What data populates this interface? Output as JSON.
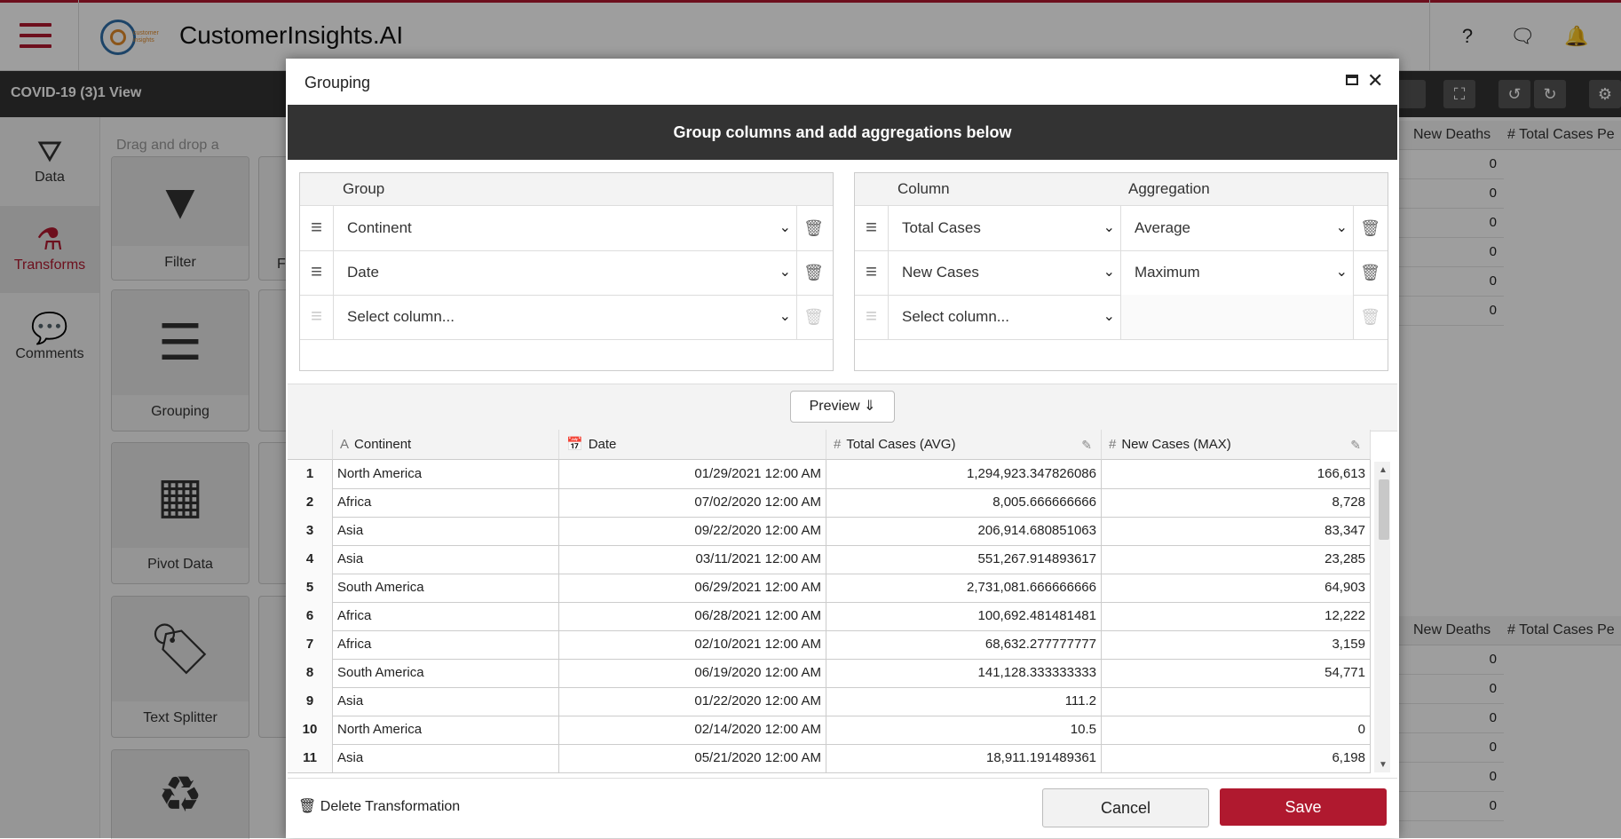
{
  "app": {
    "title": "CustomerInsights.AI",
    "logo_text": "customer insights"
  },
  "view": {
    "title": "COVID-19 (3)1 View"
  },
  "rail": [
    {
      "label": "Data",
      "icon": "database-icon"
    },
    {
      "label": "Transforms",
      "icon": "flask-icon"
    },
    {
      "label": "Comments",
      "icon": "comments-icon"
    }
  ],
  "transforms_panel": {
    "hint": "Drag and drop a transformation",
    "tiles": [
      {
        "label": "Filter",
        "icon": "filter-icon"
      },
      {
        "label": "Grouping",
        "icon": "grouping-icon"
      },
      {
        "label": "Pivot Data",
        "icon": "pivot-icon"
      },
      {
        "label": "Text Splitter",
        "icon": "tag-icon"
      },
      {
        "label": "",
        "icon": "refresh-table-icon"
      }
    ],
    "partial_label": "Fi"
  },
  "background_table": {
    "headers": [
      "New Deaths",
      "Total Cases Pe"
    ],
    "values_top": [
      "0",
      "0",
      "0",
      "0",
      "0",
      "0"
    ],
    "values_bottom": [
      "0",
      "0",
      "0",
      "0",
      "0",
      "0"
    ]
  },
  "modal": {
    "title": "Grouping",
    "banner": "Group columns and add aggregations below",
    "group": {
      "header": "Group",
      "rows": [
        {
          "value": "Continent"
        },
        {
          "value": "Date"
        },
        {
          "value": "Select column..."
        }
      ]
    },
    "aggregation": {
      "col_header": "Column",
      "agg_header": "Aggregation",
      "rows": [
        {
          "column": "Total Cases",
          "agg": "Average"
        },
        {
          "column": "New Cases",
          "agg": "Maximum"
        },
        {
          "column": "Select column...",
          "agg": ""
        }
      ]
    },
    "preview_label": "Preview",
    "preview": {
      "headers": [
        "Continent",
        "Date",
        "Total Cases (AVG)",
        "New Cases (MAX)"
      ],
      "rows": [
        [
          "1",
          "North America",
          "01/29/2021 12:00 AM",
          "1,294,923.347826086",
          "166,613"
        ],
        [
          "2",
          "Africa",
          "07/02/2020 12:00 AM",
          "8,005.666666666",
          "8,728"
        ],
        [
          "3",
          "Asia",
          "09/22/2020 12:00 AM",
          "206,914.680851063",
          "83,347"
        ],
        [
          "4",
          "Asia",
          "03/11/2021 12:00 AM",
          "551,267.914893617",
          "23,285"
        ],
        [
          "5",
          "South America",
          "06/29/2021 12:00 AM",
          "2,731,081.666666666",
          "64,903"
        ],
        [
          "6",
          "Africa",
          "06/28/2021 12:00 AM",
          "100,692.481481481",
          "12,222"
        ],
        [
          "7",
          "Africa",
          "02/10/2021 12:00 AM",
          "68,632.277777777",
          "3,159"
        ],
        [
          "8",
          "South America",
          "06/19/2020 12:00 AM",
          "141,128.333333333",
          "54,771"
        ],
        [
          "9",
          "Asia",
          "01/22/2020 12:00 AM",
          "111.2",
          ""
        ],
        [
          "10",
          "North America",
          "02/14/2020 12:00 AM",
          "10.5",
          "0"
        ],
        [
          "11",
          "Asia",
          "05/21/2020 12:00 AM",
          "18,911.191489361",
          "6,198"
        ]
      ]
    },
    "delete_label": "Delete Transformation",
    "cancel_label": "Cancel",
    "save_label": "Save"
  }
}
